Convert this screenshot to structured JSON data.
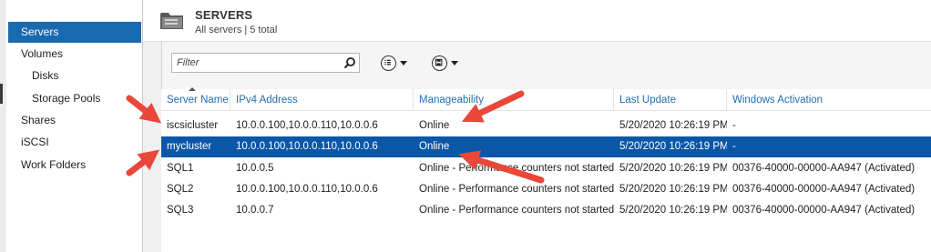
{
  "header": {
    "title": "SERVERS",
    "subtitle": "All servers | 5 total"
  },
  "sidebar": {
    "items": [
      {
        "label": "Servers",
        "selected": true
      },
      {
        "label": "Volumes"
      },
      {
        "label": "Disks"
      },
      {
        "label": "Storage Pools"
      },
      {
        "label": "Shares"
      },
      {
        "label": "iSCSI"
      },
      {
        "label": "Work Folders"
      }
    ]
  },
  "toolbar": {
    "filter_placeholder": "Filter",
    "icons": [
      "search-icon",
      "list-options-icon",
      "save-icon"
    ]
  },
  "table": {
    "columns": [
      "Server Name",
      "IPv4 Address",
      "Manageability",
      "Last Update",
      "Windows Activation"
    ],
    "rows": [
      {
        "name": "iscsicluster",
        "ipv4": "10.0.0.100,10.0.0.110,10.0.0.6",
        "manageability": "Online",
        "last_update": "5/20/2020 10:26:19 PM",
        "activation": "-"
      },
      {
        "name": "mycluster",
        "ipv4": "10.0.0.100,10.0.0.110,10.0.0.6",
        "manageability": "Online",
        "last_update": "5/20/2020 10:26:19 PM",
        "activation": "-",
        "selected": true
      },
      {
        "name": "SQL1",
        "ipv4": "10.0.0.5",
        "manageability": "Online - Performance counters not started",
        "last_update": "5/20/2020 10:26:19 PM",
        "activation": "00376-40000-00000-AA947 (Activated)"
      },
      {
        "name": "SQL2",
        "ipv4": "10.0.0.100,10.0.0.110,10.0.0.6",
        "manageability": "Online - Performance counters not started",
        "last_update": "5/20/2020 10:26:19 PM",
        "activation": "00376-40000-00000-AA947 (Activated)"
      },
      {
        "name": "SQL3",
        "ipv4": "10.0.0.7",
        "manageability": "Online - Performance counters not started",
        "last_update": "5/20/2020 10:26:19 PM",
        "activation": "00376-40000-00000-AA947 (Activated)"
      }
    ]
  },
  "colors": {
    "selection": "#0a57a8",
    "nav_selection": "#1a6ab0",
    "header_text": "#1f6fb2",
    "annotation_arrow": "#e8473a"
  }
}
